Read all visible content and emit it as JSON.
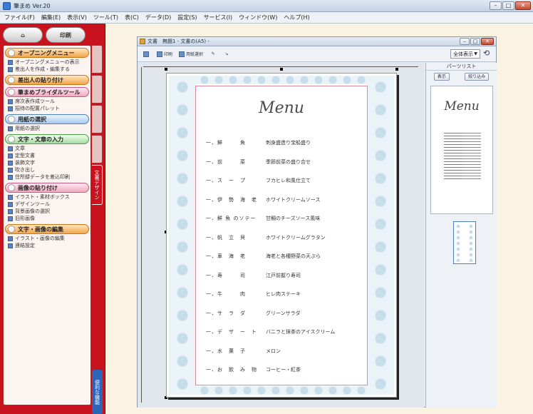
{
  "window": {
    "title": "筆まめ Ver.20"
  },
  "menubar": [
    "ファイル(F)",
    "編集(E)",
    "表示(V)",
    "ツール(T)",
    "表(C)",
    "データ(D)",
    "設定(S)",
    "サービス(I)",
    "ウィンドウ(W)",
    "ヘルプ(H)"
  ],
  "left_panel": {
    "top_buttons": [
      "",
      "印刷"
    ],
    "sections": [
      {
        "title": "オープニングメニュー",
        "color": "orange",
        "items": [
          "オープニングメニューの表示",
          "差出人を作成・編集する"
        ]
      },
      {
        "title": "差出人の貼り付け",
        "color": "orange",
        "items": []
      },
      {
        "title": "筆まめブライダルツール",
        "color": "pink",
        "items": [
          "席次表作成ツール",
          "招待の配置パレット"
        ]
      },
      {
        "title": "用紙の選択",
        "color": "blue",
        "items": [
          "用紙の選択"
        ]
      },
      {
        "title": "文字・文章の入力",
        "color": "green",
        "items": [
          "文章",
          "定型文書",
          "装飾文字",
          "吹き出し",
          "住所録データを差込印刷"
        ]
      },
      {
        "title": "画像の貼り付け",
        "color": "pink",
        "items": [
          "イラスト・素材ボックス",
          "デザインツール",
          "背景画像の選択",
          "旧形画像"
        ]
      },
      {
        "title": "文字・画像の編集",
        "color": "orange",
        "items": [
          "イラスト・画像の編集",
          "連結設定"
        ]
      }
    ],
    "vtabs": [
      "",
      "",
      "",
      "",
      "文書デザイン"
    ],
    "bottom_tab": "便利な機能"
  },
  "document": {
    "title": "文書　無題1 - 文書の(A5) -",
    "toolbar": [
      "印刷",
      "用紙選択",
      "",
      ""
    ],
    "zoom": "全体表示",
    "menu_title": "Menu",
    "menu_items": [
      {
        "category": "一、鮮　　　魚",
        "dish": "刺身盛造り宝船盛り"
      },
      {
        "category": "一、前　　　菜",
        "dish": "季節前菜の盛り合せ"
      },
      {
        "category": "一、ス　ー　プ",
        "dish": "フカヒレ和風仕立て"
      },
      {
        "category": "一、伊　勢　海　老",
        "dish": "ホワイトクリームソース"
      },
      {
        "category": "一、鮮 魚 のソテー",
        "dish": "甘鯛のチーズソース風味"
      },
      {
        "category": "一、帆　立　貝",
        "dish": "ホワイトクリームグラタン"
      },
      {
        "category": "一、車　海　老",
        "dish": "海老と各種野菜の天ぷら"
      },
      {
        "category": "一、寿　　　司",
        "dish": "江戸前握り寿司"
      },
      {
        "category": "一、牛　　　肉",
        "dish": "ヒレ肉ステーキ"
      },
      {
        "category": "一、サ　ラ　ダ",
        "dish": "グリーンサラダ"
      },
      {
        "category": "一、デ　ザ　ー　ト",
        "dish": "バニラと抹茶のアイスクリーム"
      },
      {
        "category": "一、水　菓　子",
        "dish": "メロン"
      },
      {
        "category": "一、お　飲　み　物",
        "dish": "コーヒー・紅茶"
      }
    ]
  },
  "side_panel": {
    "title": "パーツリスト",
    "buttons": [
      "表示",
      "絞り込み"
    ],
    "thumb_title": "Menu"
  }
}
